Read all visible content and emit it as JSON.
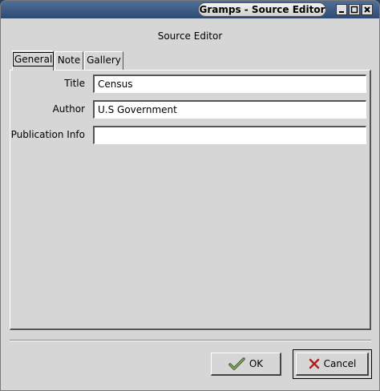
{
  "window": {
    "title": "Gramps - Source Editor",
    "controls": {
      "minimize": "minimize-icon",
      "maximize": "maximize-icon",
      "close": "close-icon"
    }
  },
  "dialog": {
    "heading": "Source Editor"
  },
  "tabs": [
    {
      "label": "General",
      "active": true
    },
    {
      "label": "Note",
      "active": false
    },
    {
      "label": "Gallery",
      "active": false
    }
  ],
  "form": {
    "title": {
      "label": "Title",
      "value": "Census"
    },
    "author": {
      "label": "Author",
      "value": "U.S Government"
    },
    "publication": {
      "label": "Publication Info",
      "value": ""
    }
  },
  "buttons": {
    "ok": {
      "label": "OK",
      "icon": "check-icon"
    },
    "cancel": {
      "label": "Cancel",
      "icon": "x-icon"
    }
  }
}
